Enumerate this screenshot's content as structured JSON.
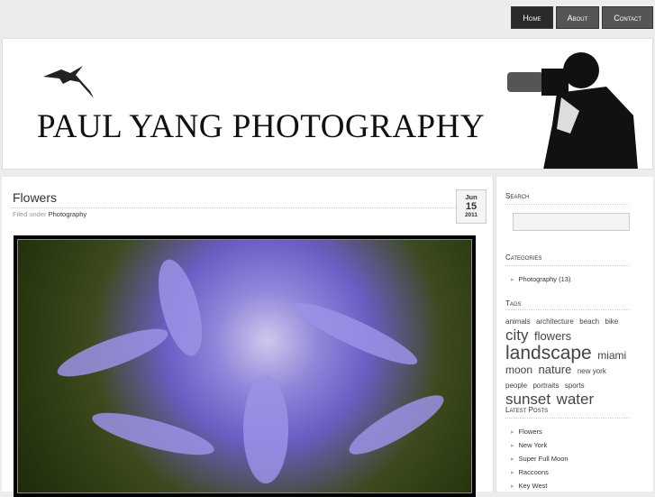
{
  "nav": [
    {
      "label": "Home"
    },
    {
      "label": "About"
    },
    {
      "label": "Contact"
    }
  ],
  "header": {
    "title": "PAUL YANG PHOTOGRAPHY"
  },
  "post": {
    "title": "Flowers",
    "filed_label": "Filed under",
    "category": "Photography",
    "date": {
      "month": "Jun",
      "day": "15",
      "year": "2011"
    }
  },
  "sidebar": {
    "search": {
      "heading": "Search",
      "value": ""
    },
    "categories": {
      "heading": "Categories",
      "items": [
        "Photography (13)"
      ]
    },
    "tags": {
      "heading": "Tags",
      "items": [
        {
          "label": "animals",
          "size": 8
        },
        {
          "label": "architecture",
          "size": 8
        },
        {
          "label": "beach",
          "size": 8
        },
        {
          "label": "bike",
          "size": 8
        },
        {
          "label": "city",
          "size": 17
        },
        {
          "label": "flowers",
          "size": 13
        },
        {
          "label": "landscape",
          "size": 21
        },
        {
          "label": "miami",
          "size": 12
        },
        {
          "label": "moon",
          "size": 12
        },
        {
          "label": "nature",
          "size": 13
        },
        {
          "label": "new york",
          "size": 8
        },
        {
          "label": "people",
          "size": 8
        },
        {
          "label": "portraits",
          "size": 8
        },
        {
          "label": "sports",
          "size": 8
        },
        {
          "label": "sunset",
          "size": 17
        },
        {
          "label": "water",
          "size": 17
        }
      ]
    },
    "latest": {
      "heading": "Latest Posts",
      "items": [
        "Flowers",
        "New York",
        "Super Full Moon",
        "Raccoons",
        "Key West"
      ]
    }
  }
}
